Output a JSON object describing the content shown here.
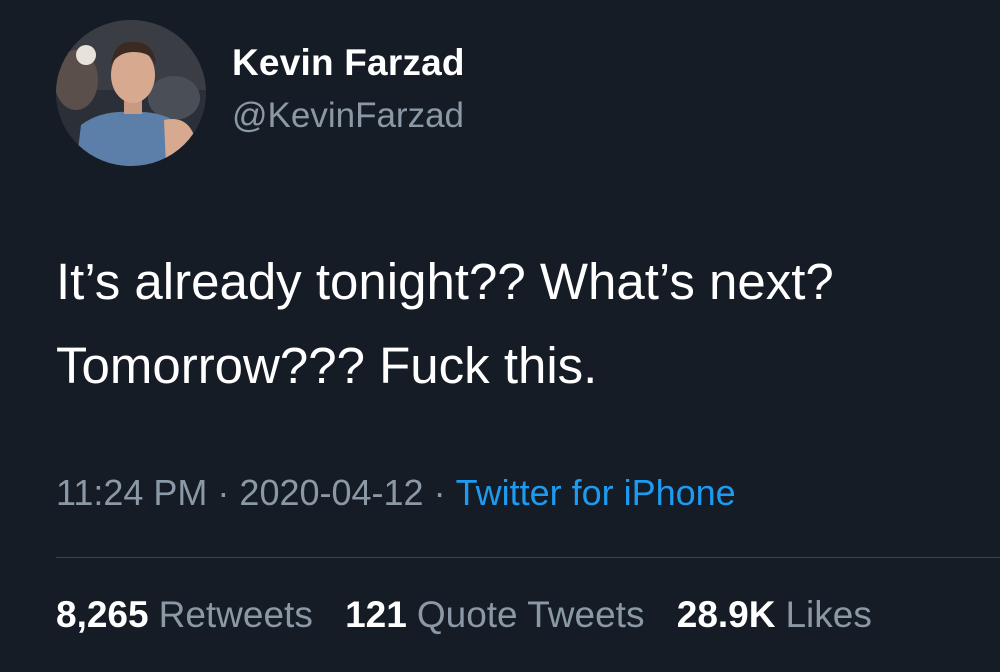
{
  "tweet": {
    "author": {
      "name": "Kevin Farzad",
      "handle": "@KevinFarzad"
    },
    "text_lines": [
      "It’s already tonight?? What’s next?",
      "Tomorrow??? Fuck this."
    ],
    "meta": {
      "time": "11:24 PM",
      "separator": "·",
      "date": "2020-04-12",
      "source": "Twitter for iPhone"
    },
    "stats": [
      {
        "count": "8,265",
        "label": "Retweets"
      },
      {
        "count": "121",
        "label": "Quote Tweets"
      },
      {
        "count": "28.9K",
        "label": "Likes"
      }
    ]
  },
  "colors": {
    "background": "#151c26",
    "primary_text": "#ffffff",
    "secondary_text": "#8b98a5",
    "link": "#1d9bf0",
    "divider": "#38444d"
  }
}
